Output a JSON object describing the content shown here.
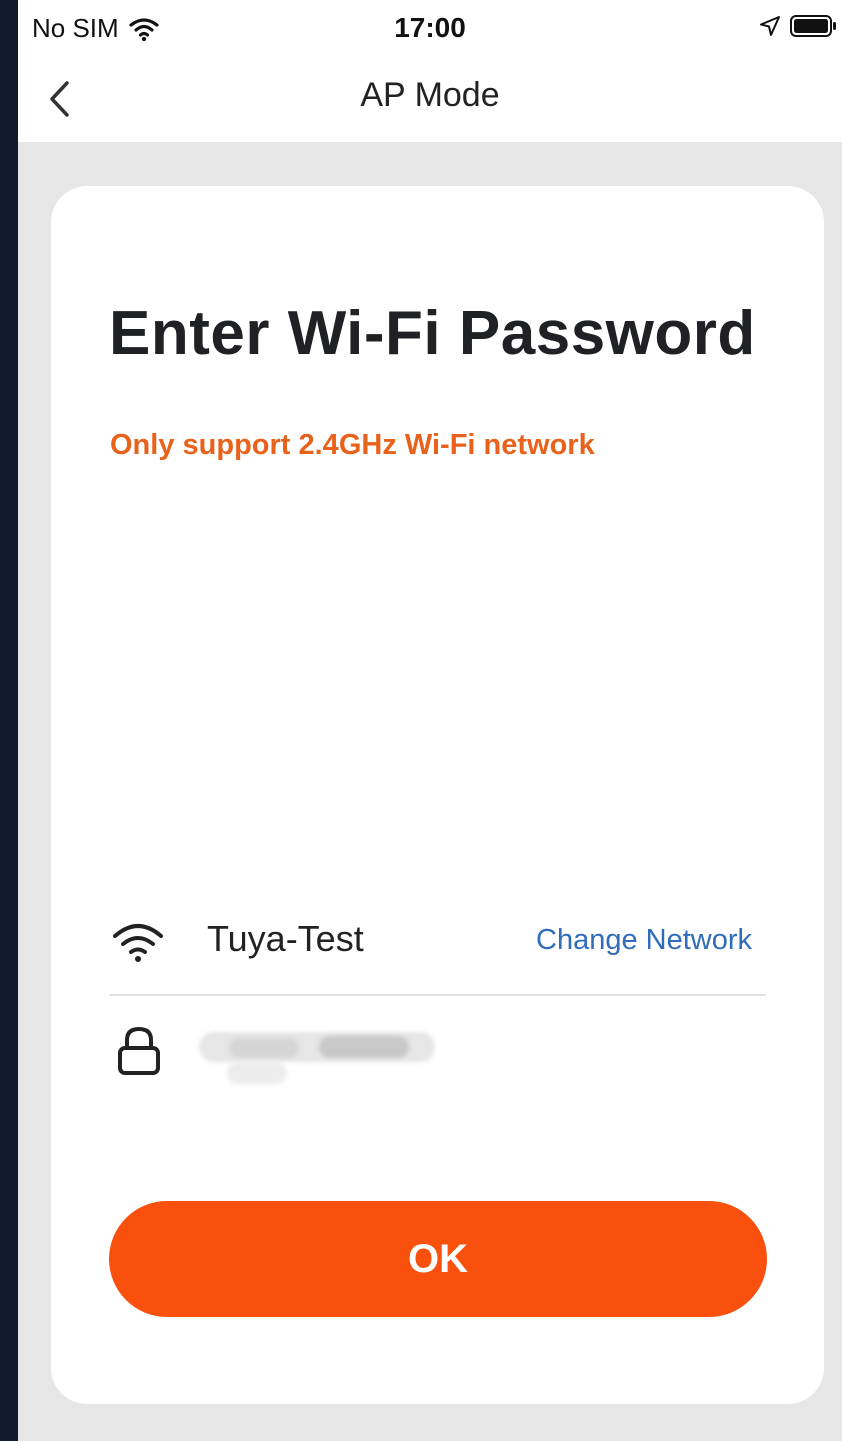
{
  "status_bar": {
    "carrier": "No SIM",
    "time": "17:00",
    "icons": [
      "wifi-icon",
      "location-icon",
      "battery-icon"
    ]
  },
  "nav": {
    "title": "AP Mode",
    "back_icon": "chevron-left-icon"
  },
  "card": {
    "heading": "Enter Wi-Fi Password",
    "warning": "Only support 2.4GHz Wi-Fi network",
    "network": {
      "icon": "wifi-icon",
      "ssid": "Tuya-Test",
      "change_label": "Change Network"
    },
    "password": {
      "icon": "lock-icon",
      "value_obscured": true
    },
    "ok_label": "OK"
  },
  "colors": {
    "accent_orange": "#f9500e",
    "warning_orange": "#e8621c",
    "link_blue": "#2f6dbc",
    "page_background": "#e6e6e6",
    "card_background": "#ffffff"
  }
}
